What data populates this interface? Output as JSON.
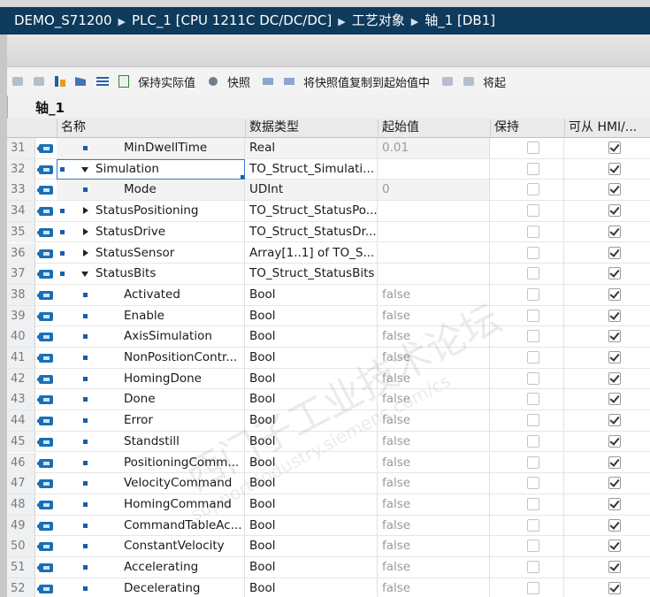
{
  "breadcrumb": [
    "DEMO_S71200",
    "PLC_1 [CPU 1211C DC/DC/DC]",
    "工艺对象",
    "轴_1 [DB1]"
  ],
  "toolbar": {
    "keep_actual": "保持实际值",
    "snapshot": "快照",
    "copy_snapshot": "将快照值复制到起始值中",
    "trailing": "将起"
  },
  "block_name": "轴_1",
  "columns": [
    "名称",
    "数据类型",
    "起始值",
    "保持",
    "可从 HMI/..."
  ],
  "rows": [
    {
      "num": "31",
      "level": 2,
      "marker": "bullet",
      "name": "MinDwellTime",
      "type": "Real",
      "start": "0.01",
      "retain": false,
      "hmi": true,
      "shade": true,
      "leftbullet": false
    },
    {
      "num": "32",
      "level": 1,
      "marker": "down",
      "name": "Simulation",
      "type": "TO_Struct_Simulati...",
      "start": "",
      "retain": false,
      "hmi": true,
      "shade": false,
      "leftbullet": true,
      "selected": true
    },
    {
      "num": "33",
      "level": 2,
      "marker": "bullet",
      "name": "Mode",
      "type": "UDInt",
      "start": "0",
      "retain": false,
      "hmi": true,
      "shade": true,
      "leftbullet": false
    },
    {
      "num": "34",
      "level": 1,
      "marker": "right",
      "name": "StatusPositioning",
      "type": "TO_Struct_StatusPo...",
      "start": "",
      "retain": false,
      "hmi": true,
      "shade": false,
      "leftbullet": true
    },
    {
      "num": "35",
      "level": 1,
      "marker": "right",
      "name": "StatusDrive",
      "type": "TO_Struct_StatusDr...",
      "start": "",
      "retain": false,
      "hmi": true,
      "shade": false,
      "leftbullet": true
    },
    {
      "num": "36",
      "level": 1,
      "marker": "right",
      "name": "StatusSensor",
      "type": "Array[1..1] of TO_S...",
      "start": "",
      "retain": false,
      "hmi": true,
      "shade": false,
      "leftbullet": true
    },
    {
      "num": "37",
      "level": 1,
      "marker": "down",
      "name": "StatusBits",
      "type": "TO_Struct_StatusBits",
      "start": "",
      "retain": false,
      "hmi": true,
      "shade": false,
      "leftbullet": true
    },
    {
      "num": "38",
      "level": 2,
      "marker": "bullet",
      "name": "Activated",
      "type": "Bool",
      "start": "false",
      "retain": false,
      "hmi": true,
      "shade": false,
      "leftbullet": false
    },
    {
      "num": "39",
      "level": 2,
      "marker": "bullet",
      "name": "Enable",
      "type": "Bool",
      "start": "false",
      "retain": false,
      "hmi": true,
      "shade": false,
      "leftbullet": false
    },
    {
      "num": "40",
      "level": 2,
      "marker": "bullet",
      "name": "AxisSimulation",
      "type": "Bool",
      "start": "false",
      "retain": false,
      "hmi": true,
      "shade": false,
      "leftbullet": false
    },
    {
      "num": "41",
      "level": 2,
      "marker": "bullet",
      "name": "NonPositionContr...",
      "type": "Bool",
      "start": "false",
      "retain": false,
      "hmi": true,
      "shade": false,
      "leftbullet": false
    },
    {
      "num": "42",
      "level": 2,
      "marker": "bullet",
      "name": "HomingDone",
      "type": "Bool",
      "start": "false",
      "retain": false,
      "hmi": true,
      "shade": false,
      "leftbullet": false
    },
    {
      "num": "43",
      "level": 2,
      "marker": "bullet",
      "name": "Done",
      "type": "Bool",
      "start": "false",
      "retain": false,
      "hmi": true,
      "shade": false,
      "leftbullet": false
    },
    {
      "num": "44",
      "level": 2,
      "marker": "bullet",
      "name": "Error",
      "type": "Bool",
      "start": "false",
      "retain": false,
      "hmi": true,
      "shade": false,
      "leftbullet": false
    },
    {
      "num": "45",
      "level": 2,
      "marker": "bullet",
      "name": "Standstill",
      "type": "Bool",
      "start": "false",
      "retain": false,
      "hmi": true,
      "shade": false,
      "leftbullet": false
    },
    {
      "num": "46",
      "level": 2,
      "marker": "bullet",
      "name": "PositioningComm...",
      "type": "Bool",
      "start": "false",
      "retain": false,
      "hmi": true,
      "shade": false,
      "leftbullet": false
    },
    {
      "num": "47",
      "level": 2,
      "marker": "bullet",
      "name": "VelocityCommand",
      "type": "Bool",
      "start": "false",
      "retain": false,
      "hmi": true,
      "shade": false,
      "leftbullet": false
    },
    {
      "num": "48",
      "level": 2,
      "marker": "bullet",
      "name": "HomingCommand",
      "type": "Bool",
      "start": "false",
      "retain": false,
      "hmi": true,
      "shade": false,
      "leftbullet": false
    },
    {
      "num": "49",
      "level": 2,
      "marker": "bullet",
      "name": "CommandTableAc...",
      "type": "Bool",
      "start": "false",
      "retain": false,
      "hmi": true,
      "shade": false,
      "leftbullet": false
    },
    {
      "num": "50",
      "level": 2,
      "marker": "bullet",
      "name": "ConstantVelocity",
      "type": "Bool",
      "start": "false",
      "retain": false,
      "hmi": true,
      "shade": false,
      "leftbullet": false
    },
    {
      "num": "51",
      "level": 2,
      "marker": "bullet",
      "name": "Accelerating",
      "type": "Bool",
      "start": "false",
      "retain": false,
      "hmi": true,
      "shade": false,
      "leftbullet": false
    },
    {
      "num": "52",
      "level": 2,
      "marker": "bullet",
      "name": "Decelerating",
      "type": "Bool",
      "start": "false",
      "retain": false,
      "hmi": true,
      "shade": false,
      "leftbullet": false
    }
  ],
  "watermark": {
    "line1": "西门子工业技术论坛",
    "line2": "support.industry.siemens.com/cs"
  },
  "colors": {
    "title_bg": "#0e3a5c",
    "accent": "#1a5da6"
  }
}
